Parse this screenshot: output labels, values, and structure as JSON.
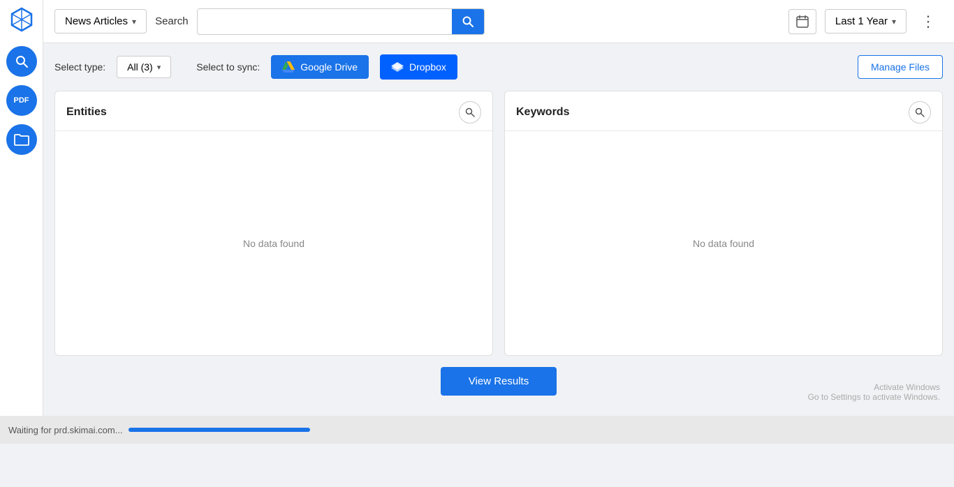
{
  "sidebar": {
    "logo_label": "Logo",
    "icons": [
      {
        "name": "search-sidebar-icon",
        "symbol": "🔍"
      },
      {
        "name": "pdf-icon",
        "symbol": "PDF"
      },
      {
        "name": "folder-icon",
        "symbol": "📁"
      }
    ]
  },
  "header": {
    "news_articles_label": "News Articles",
    "search_label": "Search",
    "search_placeholder": "",
    "calendar_symbol": "📅",
    "date_range_label": "Last 1 Year",
    "more_symbol": "⋮"
  },
  "toolbar": {
    "select_type_label": "Select type:",
    "all_select_label": "All (3)",
    "select_sync_label": "Select to sync:",
    "google_drive_label": "Google Drive",
    "dropbox_label": "Dropbox",
    "manage_files_label": "Manage Files"
  },
  "entities_panel": {
    "title": "Entities",
    "no_data_text": "No data found"
  },
  "keywords_panel": {
    "title": "Keywords",
    "no_data_text": "No data found"
  },
  "view_results": {
    "label": "View Results"
  },
  "status_bar": {
    "text": "Waiting for prd.skimai.com..."
  },
  "activate_windows": {
    "line1": "Activate Windows",
    "line2": "Go to Settings to activate Windows."
  }
}
